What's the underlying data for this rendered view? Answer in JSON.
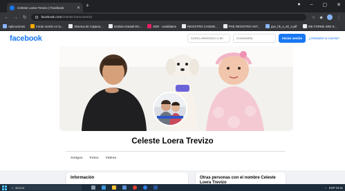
{
  "browser": {
    "tab_title": "Celeste Loera Trevizo | Facebook",
    "url_host": "facebook.com",
    "url_path": "/celeste.loera.trevizo",
    "bookmarks": [
      {
        "label": "Aplicaciones",
        "color": "#8ab4f8"
      },
      {
        "label": "Iniciar sesión en la...",
        "color": "#f9ab00"
      },
      {
        "label": "Sistema de Captura...",
        "color": "#e8eaed"
      },
      {
        "label": "Instituto Estatal Ele...",
        "color": "#e8eaed"
      },
      {
        "label": "SNR · candidatos",
        "color": "#e91e63"
      },
      {
        "label": "REGISTRO CANDID...",
        "color": "#e8eaed"
      },
      {
        "label": "PGE REGISTRO ANT...",
        "color": "#e8eaed"
      },
      {
        "label": "pye_hk_a_ntl_1.pdf",
        "color": "#8ab4f8"
      },
      {
        "label": "INE FORMS SRE S...",
        "color": "#e8eaed"
      }
    ]
  },
  "facebook": {
    "logo": "facebook",
    "login": {
      "email_placeholder": "Correo electrónico o tel",
      "password_placeholder": "Contraseña",
      "login_button": "Iniciar sesión",
      "forgot_link": "¿Olvidaste tu cuenta?"
    },
    "accent": "#1877f2"
  },
  "profile": {
    "name": "Celeste Loera Trevizo",
    "tabs": [
      "Amigos",
      "Fotos",
      "Videos"
    ]
  },
  "cards": {
    "info_title": "Información",
    "others_title": "Otras personas con el nombre Celeste Loera Trevizo"
  },
  "taskbar": {
    "search_placeholder": "Buscar",
    "tray_text": "ESP 10:41"
  },
  "icons": [
    "favicon-icon",
    "back-icon",
    "forward-icon",
    "reload-icon",
    "lock-icon",
    "windows-icon",
    "search-icon"
  ]
}
